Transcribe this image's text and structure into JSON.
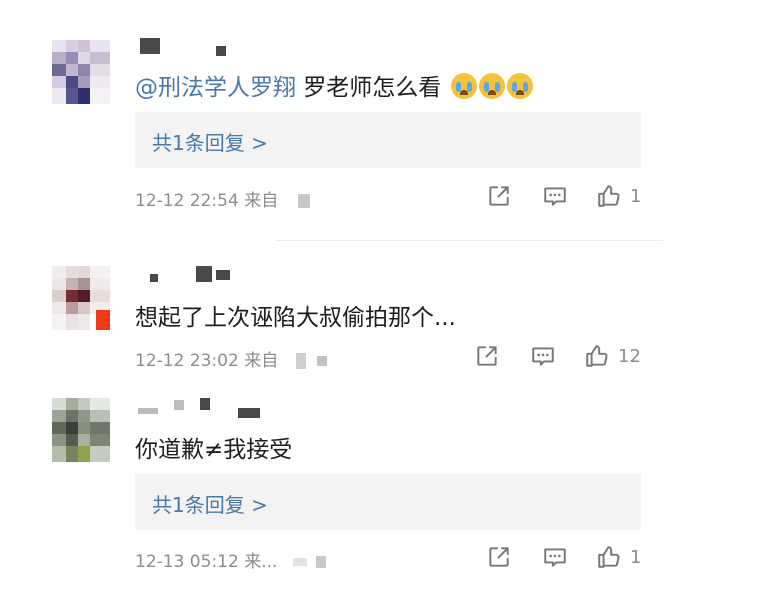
{
  "comments": [
    {
      "mention": "@刑法学人罗翔",
      "text": " 罗老师怎么看",
      "emoji_count": 3,
      "reply_label": "共1条回复 >",
      "timestamp": "12-12 22:54",
      "source": "来自",
      "likes": "1"
    },
    {
      "text": "想起了上次诬陷大叔偷拍那个...",
      "timestamp": "12-12 23:02",
      "source": "来自",
      "likes": "12"
    },
    {
      "text": "你道歉≠我接受",
      "reply_label": "共1条回复 >",
      "timestamp": "12-13 05:12",
      "source": "来...",
      "likes": "1"
    }
  ],
  "icons": {
    "share": "share-icon",
    "comment": "comment-icon",
    "like": "thumbs-up-icon",
    "emoji": "crying-face-emoji"
  },
  "colors": {
    "link": "#4a78a8",
    "meta": "#8d8d8d",
    "reply_bg": "#f3f3f3"
  }
}
